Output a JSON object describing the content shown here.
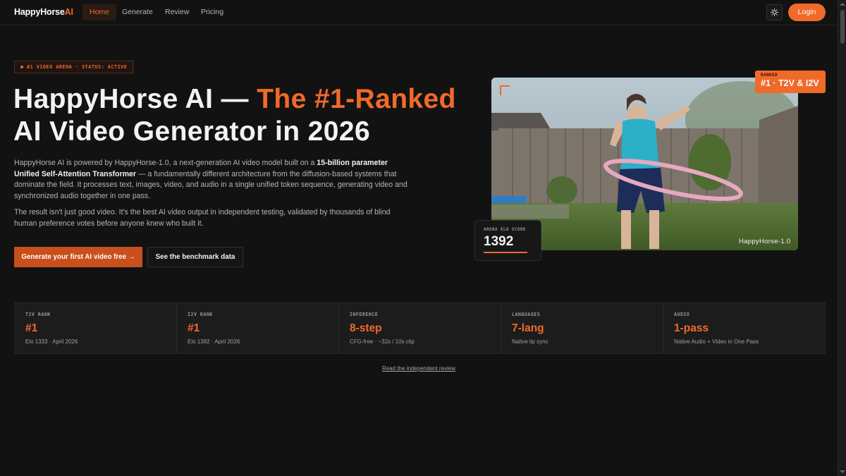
{
  "nav": {
    "logo_main": "HappyHorse",
    "logo_ai": "AI",
    "links": [
      "Home",
      "Generate",
      "Review",
      "Pricing"
    ],
    "active_index": 0,
    "login_label": "Login"
  },
  "hero": {
    "badge": "#1 VIDEO ARENA · STATUS: ACTIVE",
    "title_part1": "HappyHorse AI — ",
    "title_highlight": "The #1-Ranked",
    "title_part2": "AI Video Generator in 2026",
    "p1_a": "HappyHorse AI is powered by HappyHorse-1.0, a next-generation AI video model built on a ",
    "p1_bold": "15-billion parameter Unified Self-Attention Transformer",
    "p1_b": " — a fundamentally different architecture from the diffusion-based systems that dominate the field. It processes text, images, video, and audio in a single unified token sequence, generating video and synchronized audio together in one pass.",
    "p2": "The result isn't just good video. It's the best AI video output in independent testing, validated by thousands of blind human preference votes before anyone knew who built it.",
    "cta_primary": "Generate your first AI video free →",
    "cta_secondary": "See the benchmark data"
  },
  "video": {
    "watermark": "HappyHorse-1.0",
    "rank_label": "RANKED",
    "rank_value": "#1 · T2V & I2V",
    "elo_label": "ARENA ELO SCORE",
    "elo_value": "1392"
  },
  "stats": [
    {
      "label": "T2V RANK",
      "value": "#1",
      "sub": "Elo 1333 · April 2026"
    },
    {
      "label": "I2V RANK",
      "value": "#1",
      "sub": "Elo 1392 · April 2026"
    },
    {
      "label": "INFERENCE",
      "value": "8-step",
      "sub": "CFG-free · ~32s / 10s clip"
    },
    {
      "label": "LANGUAGES",
      "value": "7-lang",
      "sub": "Native lip sync"
    },
    {
      "label": "AUDIO",
      "value": "1-pass",
      "sub": "Native Audio + Video in One Pass"
    }
  ],
  "review_link": "Read the independent review",
  "colors": {
    "accent": "#f06a2a",
    "background": "#121212",
    "panel": "#1c1c1c"
  },
  "icons": {
    "theme_toggle": "sun-icon",
    "cta_arrow": "arrow-right-icon"
  }
}
